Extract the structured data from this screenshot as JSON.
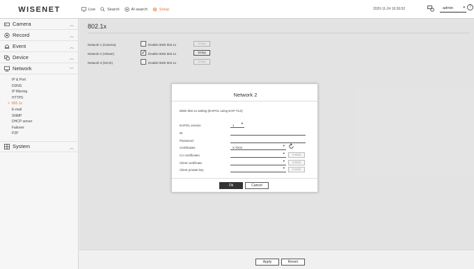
{
  "header": {
    "logo": "WISENET",
    "nav": [
      {
        "label": "Live",
        "icon": "monitor-icon"
      },
      {
        "label": "Search",
        "icon": "search-icon"
      },
      {
        "label": "AI search",
        "icon": "ai-search-icon"
      },
      {
        "label": "Setup",
        "icon": "gear-icon"
      }
    ],
    "datetime": "2020-11-24 16:36:52",
    "user": "admin",
    "help": "?",
    "accent": "#e8723a"
  },
  "sidebar": {
    "menus": [
      {
        "label": "Camera",
        "icon": "camera-icon"
      },
      {
        "label": "Record",
        "icon": "record-icon"
      },
      {
        "label": "Event",
        "icon": "bell-icon"
      },
      {
        "label": "Device",
        "icon": "device-icon"
      },
      {
        "label": "Network",
        "icon": "network-icon"
      }
    ],
    "network_items": [
      "IP & Port",
      "DDNS",
      "IP filtering",
      "HTTPS",
      "802.1x",
      "E-mail",
      "SNMP",
      "DHCP server",
      "Failover",
      "P2P"
    ],
    "active_item": "802.1x",
    "active_marker": ">",
    "system": {
      "label": "System",
      "icon": "system-icon"
    }
  },
  "main": {
    "title": "802.1x",
    "rows": [
      {
        "label": "Network 1 (Camera)",
        "enable": "Enable IEEE 802.1x",
        "checked": false,
        "setup": "Setup"
      },
      {
        "label": "Network 2 (Viewer)",
        "enable": "Enable IEEE 802.1x",
        "checked": true,
        "setup": "Setup"
      },
      {
        "label": "Network 3 (iSCSI)",
        "enable": "Enable IEEE 802.1x",
        "checked": false,
        "setup": "Setup"
      }
    ]
  },
  "dialog": {
    "title": "Network 2",
    "description": "IEEE 802.1x setting (EAPOL using EAP-TLS)",
    "fields": {
      "eapol_label": "EAPOL version",
      "eapol_value": "1",
      "id_label": "ID",
      "id_value": "",
      "password_label": "Password",
      "password_value": "",
      "certificates_label": "Certificates",
      "certificates_value": "X TICK",
      "ca_label": "CA certificates",
      "ca_value": "",
      "client_cert_label": "Client certificate",
      "client_cert_value": "",
      "client_key_label": "Client private key",
      "client_key_value": ""
    },
    "install_label": "Install",
    "ok_label": "Ok",
    "cancel_label": "Cancel"
  },
  "footer": {
    "apply_label": "Apply",
    "revert_label": "Revert"
  }
}
